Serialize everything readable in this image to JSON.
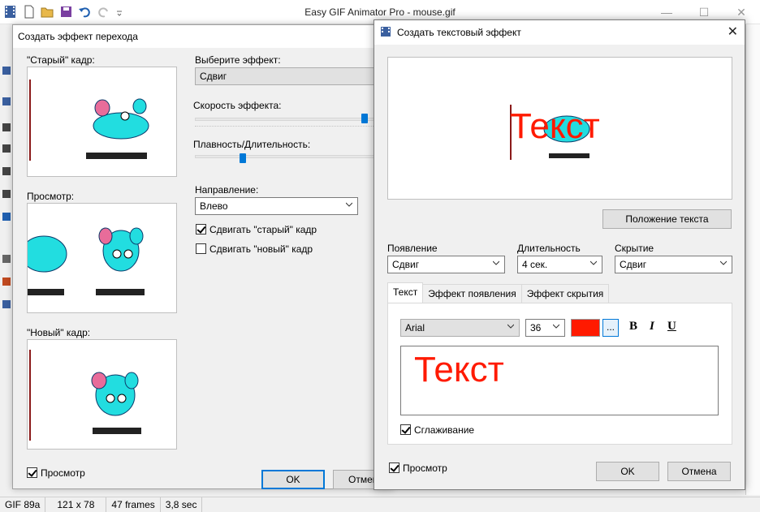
{
  "app": {
    "title": "Easy GIF Animator Pro - mouse.gif",
    "window_controls": [
      "—",
      "☐",
      "✕"
    ]
  },
  "status": {
    "format": "GIF 89a",
    "size": "121 x 78",
    "frames": "47 frames",
    "duration": "3,8 sec"
  },
  "transition_dialog": {
    "title": "Создать эффект перехода",
    "old_frame_label": "\"Старый\" кадр:",
    "preview_label": "Просмотр:",
    "new_frame_label": "\"Новый\" кадр:",
    "choose_effect_label": "Выберите эффект:",
    "effect_value": "Сдвиг",
    "speed_label": "Скорость эффекта:",
    "speed_value": 0.95,
    "smoothness_label": "Плавность/Длительность:",
    "smoothness_value": 0.27,
    "direction_label": "Направление:",
    "direction_value": "Влево",
    "shift_old_label": "Сдвигать \"старый\" кадр",
    "shift_old_checked": true,
    "shift_new_label": "Сдвигать \"новый\" кадр",
    "shift_new_checked": false,
    "preview_check_label": "Просмотр",
    "preview_checked": true,
    "ok_label": "OK",
    "cancel_label": "Отмена"
  },
  "text_dialog": {
    "title": "Создать текстовый эффект",
    "preview_text": "Текст",
    "position_button": "Положение текста",
    "appear_label": "Появление",
    "appear_value": "Сдвиг",
    "duration_label": "Длительность",
    "duration_value": "4 сек.",
    "hide_label": "Скрытие",
    "hide_value": "Сдвиг",
    "tabs": [
      "Текст",
      "Эффект появления",
      "Эффект скрытия"
    ],
    "font_value": "Arial",
    "size_value": "36",
    "color": "#ff1a00",
    "more_button": "...",
    "bold": "B",
    "italic": "I",
    "underline": "U",
    "text_value": "Текст",
    "antialias_label": "Сглаживание",
    "antialias_checked": true,
    "preview_check_label": "Просмотр",
    "preview_checked": true,
    "ok_label": "OK",
    "cancel_label": "Отмена"
  }
}
